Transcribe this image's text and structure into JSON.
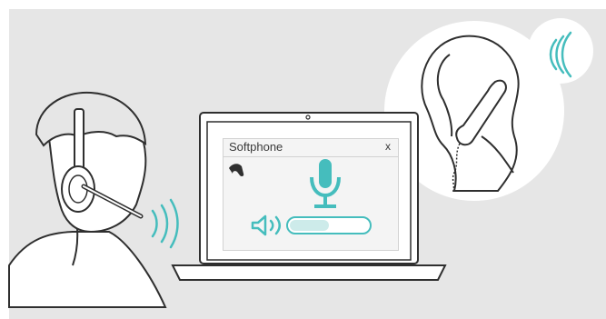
{
  "softphone": {
    "title": "Softphone",
    "close_label": "x",
    "volume_level": 0.5
  },
  "icons": {
    "handset": "phone-handset-icon",
    "microphone": "microphone-icon",
    "speaker": "speaker-volume-icon",
    "sound_waves": "sound-waves-icon",
    "close": "close-icon"
  },
  "colors": {
    "accent": "#45bdbd",
    "accent_light": "#cdebea",
    "line": "#2f2f2f",
    "background": "#e6e6e6"
  }
}
